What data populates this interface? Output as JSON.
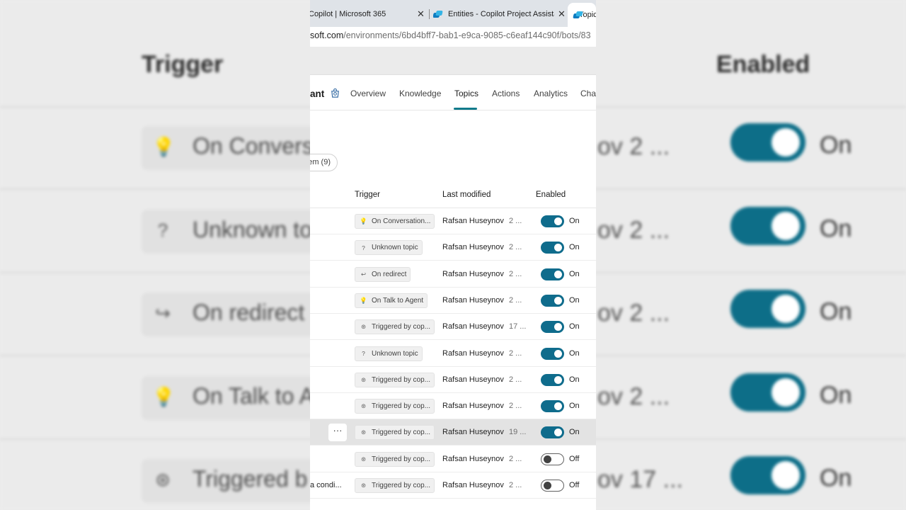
{
  "background": {
    "header_trigger": "Trigger",
    "header_enabled": "Enabled",
    "rows": [
      {
        "icon": "lightbulb-icon",
        "glyph": "💡",
        "trigger": "On Convers",
        "modified": "ov  2 ...",
        "state": "On"
      },
      {
        "icon": "question-icon",
        "glyph": "?",
        "trigger": "Unknown to",
        "modified": "ov  2 ...",
        "state": "On"
      },
      {
        "icon": "redirect-icon",
        "glyph": "↪",
        "trigger": "On redirect",
        "modified": "ov  2 ...",
        "state": "On"
      },
      {
        "icon": "lightbulb-icon",
        "glyph": "💡",
        "trigger": "On Talk to A",
        "modified": "ov  2 ...",
        "state": "On"
      },
      {
        "icon": "copilot-icon",
        "glyph": "⊛",
        "trigger": "Triggered b",
        "modified": "ov  17 ...",
        "state": "On"
      }
    ]
  },
  "browser": {
    "tabs": [
      {
        "label": "Copilot | Microsoft 365"
      },
      {
        "label": "Entities - Copilot Project Assistant"
      },
      {
        "label": "Topics"
      }
    ],
    "url_domain": "soft.com",
    "url_path": "/environments/6bd4bff7-bab1-e9ca-9085-c6eaf144c90f/bots/83"
  },
  "nav": {
    "agent_name": "ant",
    "items": [
      "Overview",
      "Knowledge",
      "Topics",
      "Actions",
      "Analytics",
      "Char"
    ]
  },
  "filter": {
    "label": "em (9)"
  },
  "table": {
    "headers": {
      "trigger": "Trigger",
      "modified": "Last modified",
      "enabled": "Enabled"
    },
    "rows": [
      {
        "name": "",
        "icon": "lightbulb-icon",
        "glyph": "💡",
        "trigger": "On Conversation...",
        "who": "Rafsan Huseynov",
        "when": "2 ...",
        "enabled": true,
        "state": "On"
      },
      {
        "name": "",
        "icon": "question-icon",
        "glyph": "?",
        "trigger": "Unknown topic",
        "who": "Rafsan Huseynov",
        "when": "2 ...",
        "enabled": true,
        "state": "On"
      },
      {
        "name": "",
        "icon": "redirect-icon",
        "glyph": "↩",
        "trigger": "On redirect",
        "who": "Rafsan Huseynov",
        "when": "2 ...",
        "enabled": true,
        "state": "On"
      },
      {
        "name": "",
        "icon": "lightbulb-icon",
        "glyph": "💡",
        "trigger": "On Talk to Agent",
        "who": "Rafsan Huseynov",
        "when": "2 ...",
        "enabled": true,
        "state": "On"
      },
      {
        "name": "",
        "icon": "copilot-icon",
        "glyph": "⊛",
        "trigger": "Triggered by cop...",
        "who": "Rafsan Huseynov",
        "when": "17 ...",
        "enabled": true,
        "state": "On"
      },
      {
        "name": "",
        "icon": "question-icon",
        "glyph": "?",
        "trigger": "Unknown topic",
        "who": "Rafsan Huseynov",
        "when": "2 ...",
        "enabled": true,
        "state": "On"
      },
      {
        "name": "",
        "icon": "copilot-icon",
        "glyph": "⊛",
        "trigger": "Triggered by cop...",
        "who": "Rafsan Huseynov",
        "when": "2 ...",
        "enabled": true,
        "state": "On"
      },
      {
        "name": "",
        "icon": "copilot-icon",
        "glyph": "⊛",
        "trigger": "Triggered by cop...",
        "who": "Rafsan Huseynov",
        "when": "2 ...",
        "enabled": true,
        "state": "On"
      },
      {
        "name": "",
        "icon": "copilot-icon",
        "glyph": "⊛",
        "trigger": "Triggered by cop...",
        "who": "Rafsan Huseynov",
        "when": "19 ...",
        "enabled": true,
        "state": "On",
        "selected": true,
        "more": "···"
      },
      {
        "name": "",
        "icon": "copilot-icon",
        "glyph": "⊛",
        "trigger": "Triggered by cop...",
        "who": "Rafsan Huseynov",
        "when": "2 ...",
        "enabled": false,
        "state": "Off"
      },
      {
        "name": "a condi...",
        "icon": "copilot-icon",
        "glyph": "⊛",
        "trigger": "Triggered by cop...",
        "who": "Rafsan Huseynov",
        "when": "2 ...",
        "enabled": false,
        "state": "Off"
      }
    ]
  }
}
